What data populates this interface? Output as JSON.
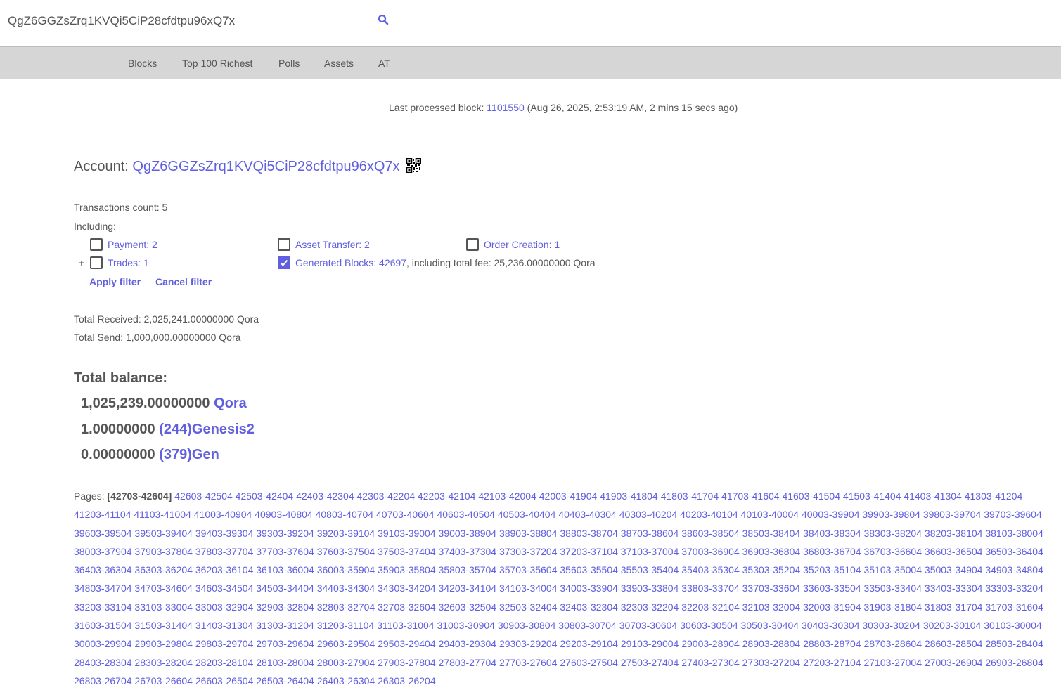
{
  "search": {
    "value": "QgZ6GGZsZrq1KVQi5CiP28cfdtpu96xQ7x"
  },
  "nav": [
    "Blocks",
    "Top 100 Richest",
    "Polls",
    "Assets",
    "AT"
  ],
  "last_block": {
    "label": "Last processed block:",
    "height": "1101550",
    "time": "(Aug 26, 2025, 2:53:19 AM, 2 mins 15 secs ago)"
  },
  "account": {
    "label": "Account:",
    "address": "QgZ6GGZsZrq1KVQi5CiP28cfdtpu96xQ7x"
  },
  "transactions": {
    "count_label": "Transactions count: 5",
    "including_label": "Including:",
    "plus": "+",
    "filters": {
      "payment": {
        "label": "Payment: 2",
        "checked": false
      },
      "asset_transfer": {
        "label": "Asset Transfer: 2",
        "checked": false
      },
      "order_creation": {
        "label": "Order Creation: 1",
        "checked": false
      },
      "trades": {
        "label": "Trades: 1",
        "checked": false
      },
      "generated_blocks": {
        "label": "Generated Blocks: 42697",
        "suffix": ", including total fee: 25,236.00000000 Qora",
        "checked": true
      }
    },
    "apply_label": "Apply filter",
    "cancel_label": "Cancel filter"
  },
  "totals": {
    "received": "Total Received: 2,025,241.00000000 Qora",
    "send": "Total Send: 1,000,000.00000000 Qora"
  },
  "balance": {
    "title": "Total balance:",
    "rows": [
      {
        "amount": "1,025,239.00000000",
        "asset": "Qora"
      },
      {
        "amount": "1.00000000",
        "asset": "(244)Genesis2"
      },
      {
        "amount": "0.00000000",
        "asset": "(379)Gen"
      }
    ]
  },
  "pages": {
    "label": "Pages:",
    "current": "[42703-42604]",
    "links": [
      "42603-42504",
      "42503-42404",
      "42403-42304",
      "42303-42204",
      "42203-42104",
      "42103-42004",
      "42003-41904",
      "41903-41804",
      "41803-41704",
      "41703-41604",
      "41603-41504",
      "41503-41404",
      "41403-41304",
      "41303-41204",
      "41203-41104",
      "41103-41004",
      "41003-40904",
      "40903-40804",
      "40803-40704",
      "40703-40604",
      "40603-40504",
      "40503-40404",
      "40403-40304",
      "40303-40204",
      "40203-40104",
      "40103-40004",
      "40003-39904",
      "39903-39804",
      "39803-39704",
      "39703-39604",
      "39603-39504",
      "39503-39404",
      "39403-39304",
      "39303-39204",
      "39203-39104",
      "39103-39004",
      "39003-38904",
      "38903-38804",
      "38803-38704",
      "38703-38604",
      "38603-38504",
      "38503-38404",
      "38403-38304",
      "38303-38204",
      "38203-38104",
      "38103-38004",
      "38003-37904",
      "37903-37804",
      "37803-37704",
      "37703-37604",
      "37603-37504",
      "37503-37404",
      "37403-37304",
      "37303-37204",
      "37203-37104",
      "37103-37004",
      "37003-36904",
      "36903-36804",
      "36803-36704",
      "36703-36604",
      "36603-36504",
      "36503-36404",
      "36403-36304",
      "36303-36204",
      "36203-36104",
      "36103-36004",
      "36003-35904",
      "35903-35804",
      "35803-35704",
      "35703-35604",
      "35603-35504",
      "35503-35404",
      "35403-35304",
      "35303-35204",
      "35203-35104",
      "35103-35004",
      "35003-34904",
      "34903-34804",
      "34803-34704",
      "34703-34604",
      "34603-34504",
      "34503-34404",
      "34403-34304",
      "34303-34204",
      "34203-34104",
      "34103-34004",
      "34003-33904",
      "33903-33804",
      "33803-33704",
      "33703-33604",
      "33603-33504",
      "33503-33404",
      "33403-33304",
      "33303-33204",
      "33203-33104",
      "33103-33004",
      "33003-32904",
      "32903-32804",
      "32803-32704",
      "32703-32604",
      "32603-32504",
      "32503-32404",
      "32403-32304",
      "32303-32204",
      "32203-32104",
      "32103-32004",
      "32003-31904",
      "31903-31804",
      "31803-31704",
      "31703-31604",
      "31603-31504",
      "31503-31404",
      "31403-31304",
      "31303-31204",
      "31203-31104",
      "31103-31004",
      "31003-30904",
      "30903-30804",
      "30803-30704",
      "30703-30604",
      "30603-30504",
      "30503-30404",
      "30403-30304",
      "30303-30204",
      "30203-30104",
      "30103-30004",
      "30003-29904",
      "29903-29804",
      "29803-29704",
      "29703-29604",
      "29603-29504",
      "29503-29404",
      "29403-29304",
      "29303-29204",
      "29203-29104",
      "29103-29004",
      "29003-28904",
      "28903-28804",
      "28803-28704",
      "28703-28604",
      "28603-28504",
      "28503-28404",
      "28403-28304",
      "28303-28204",
      "28203-28104",
      "28103-28004",
      "28003-27904",
      "27903-27804",
      "27803-27704",
      "27703-27604",
      "27603-27504",
      "27503-27404",
      "27403-27304",
      "27303-27204",
      "27203-27104",
      "27103-27004",
      "27003-26904",
      "26903-26804",
      "26803-26704",
      "26703-26604",
      "26603-26504",
      "26503-26404",
      "26403-26304",
      "26303-26204"
    ]
  },
  "colors": {
    "link": "#5f5fe0",
    "text": "#555555",
    "nav_bg": "#d6d6d6"
  }
}
